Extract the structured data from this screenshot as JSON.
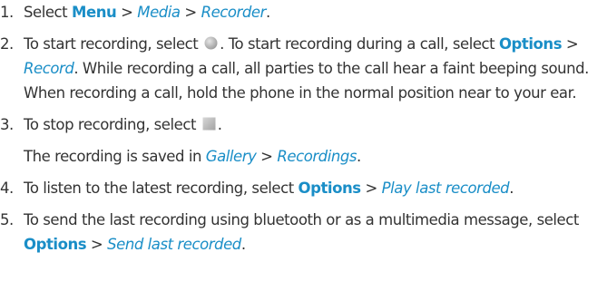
{
  "steps": [
    {
      "number": "1.",
      "t1": "Select ",
      "menu": "Menu",
      "sep1": " > ",
      "media": "Media",
      "sep2": " > ",
      "recorder": "Recorder",
      "t2": "."
    },
    {
      "number": "2.",
      "t1": "To start recording, select ",
      "icon": "record-button-icon",
      "t2": ". To start recording during a call, select ",
      "options": "Options",
      "sep1": " > ",
      "record": "Record",
      "t3": ". While recording a call, all parties to the call hear a faint beeping sound. When recording a call, hold the phone in the normal position near to your ear."
    },
    {
      "number": "3.",
      "t1": "To stop recording, select ",
      "icon": "stop-button-icon",
      "t2": ".",
      "note": {
        "t1": "The recording is saved in ",
        "gallery": "Gallery",
        "sep1": " > ",
        "recordings": "Recordings",
        "t2": "."
      }
    },
    {
      "number": "4.",
      "t1": "To listen to the latest recording, select ",
      "options": "Options",
      "sep1": " > ",
      "play": "Play last recorded",
      "t2": "."
    },
    {
      "number": "5.",
      "t1": "To send the last recording using bluetooth or as a multimedia message, select ",
      "options": "Options",
      "sep1": " > ",
      "send": "Send last recorded",
      "t2": "."
    }
  ],
  "colors": {
    "text": "#333333",
    "link": "#1a8ec7",
    "icon_gray": "#b4b4b4"
  }
}
